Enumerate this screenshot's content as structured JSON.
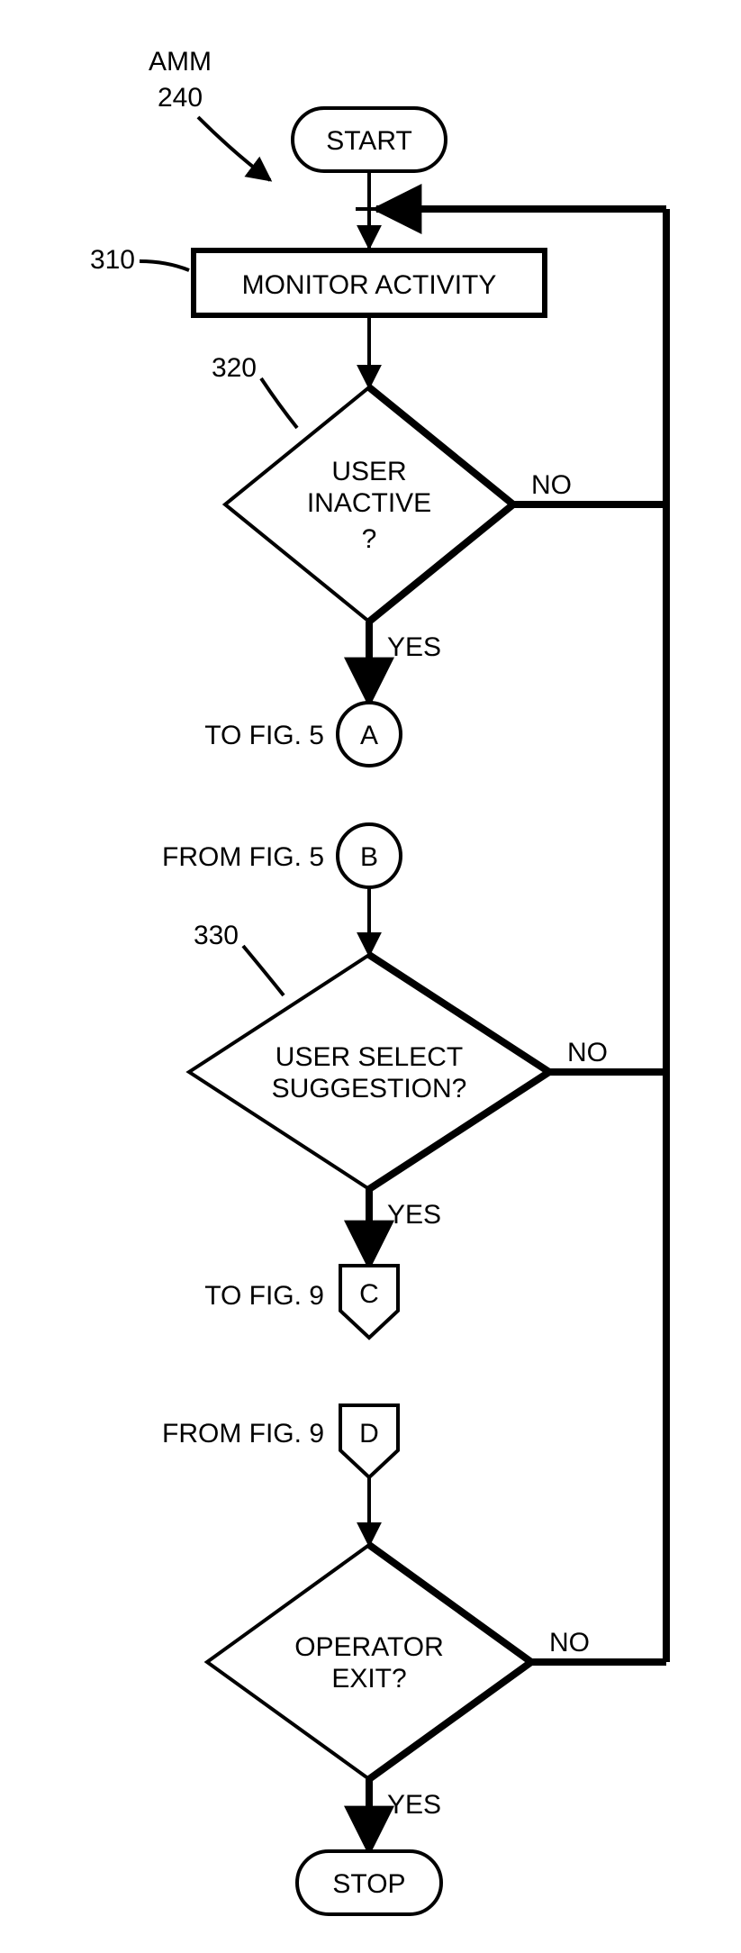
{
  "chart_data": {
    "type": "flowchart",
    "title": "AMM 240",
    "nodes": [
      {
        "id": "start",
        "type": "terminator",
        "label": "START"
      },
      {
        "id": "310",
        "type": "process",
        "ref": "310",
        "label": "MONITOR ACTIVITY"
      },
      {
        "id": "320",
        "type": "decision",
        "ref": "320",
        "label": "USER INACTIVE ?"
      },
      {
        "id": "A",
        "type": "onpage-circle",
        "label": "A",
        "note": "TO FIG. 5"
      },
      {
        "id": "B",
        "type": "onpage-circle",
        "label": "B",
        "note": "FROM FIG. 5"
      },
      {
        "id": "330",
        "type": "decision",
        "ref": "330",
        "label": "USER SELECT SUGGESTION?"
      },
      {
        "id": "C",
        "type": "offpage-down",
        "label": "C",
        "note": "TO FIG. 9"
      },
      {
        "id": "D",
        "type": "offpage-up",
        "label": "D",
        "note": "FROM FIG. 9"
      },
      {
        "id": "exit",
        "type": "decision",
        "label": "OPERATOR EXIT?"
      },
      {
        "id": "stop",
        "type": "terminator",
        "label": "STOP"
      }
    ],
    "edges": [
      {
        "from": "start",
        "to": "310"
      },
      {
        "from": "310",
        "to": "320"
      },
      {
        "from": "320",
        "to": "A",
        "label": "YES"
      },
      {
        "from": "320",
        "to": "310",
        "label": "NO",
        "loopback": true
      },
      {
        "from": "B",
        "to": "330"
      },
      {
        "from": "330",
        "to": "C",
        "label": "YES"
      },
      {
        "from": "330",
        "to": "310",
        "label": "NO",
        "loopback": true
      },
      {
        "from": "D",
        "to": "exit"
      },
      {
        "from": "exit",
        "to": "stop",
        "label": "YES"
      },
      {
        "from": "exit",
        "to": "310",
        "label": "NO",
        "loopback": true
      }
    ]
  },
  "header": {
    "amm": "AMM",
    "amm_num": "240"
  },
  "refs": {
    "r310": "310",
    "r320": "320",
    "r330": "330"
  },
  "nodes": {
    "start": "START",
    "monitor": "MONITOR ACTIVITY",
    "inactive1": "USER",
    "inactive2": "INACTIVE",
    "inactive3": "?",
    "labelA": "A",
    "noteA": "TO FIG. 5",
    "labelB": "B",
    "noteB": "FROM FIG. 5",
    "select1": "USER SELECT",
    "select2": "SUGGESTION?",
    "labelC": "C",
    "noteC": "TO FIG. 9",
    "labelD": "D",
    "noteD": "FROM FIG. 9",
    "exit1": "OPERATOR",
    "exit2": "EXIT?",
    "stop": "STOP"
  },
  "edges": {
    "yes": "YES",
    "no": "NO"
  }
}
